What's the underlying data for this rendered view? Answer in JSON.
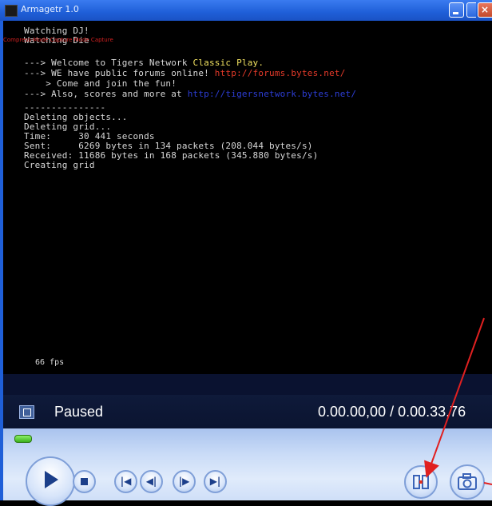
{
  "window": {
    "title": "Armagetr 1.0"
  },
  "overlay_text": "Compress-Mode Capture Mode Capture",
  "console": {
    "lines": [
      [
        {
          "t": "Watching DJ!"
        }
      ],
      [
        {
          "t": "Watching Die"
        }
      ],
      [
        {
          "t": "---> Welcome to Tigers Network "
        },
        {
          "t": "Classic Play.",
          "c": "y"
        }
      ],
      [
        {
          "t": "---> WE have public forums online! "
        },
        {
          "t": "http://forums.bytes.net/",
          "c": "r"
        }
      ],
      [
        {
          "t": "    > Come and join the fun!"
        }
      ],
      [
        {
          "t": "---> Also, scores and more at "
        },
        {
          "t": "http://tigersnetwork.bytes.net/",
          "c": "b"
        }
      ],
      [
        {
          "t": "---------------"
        }
      ],
      [
        {
          "t": "Deleting objects..."
        }
      ],
      [
        {
          "t": "Deleting grid..."
        }
      ],
      [
        {
          "t": "Time:     30 441 seconds"
        }
      ],
      [
        {
          "t": "Sent:     6269 bytes in 134 packets (208.044 bytes/s)"
        }
      ],
      [
        {
          "t": "Received: 11686 bytes in 168 packets (345.880 bytes/s)"
        }
      ],
      [
        {
          "t": "Creating grid"
        }
      ]
    ],
    "fps": "66 fps"
  },
  "player": {
    "status": "Paused",
    "time": "0.00.00,00 / 0.00.33,76",
    "seek_fraction": 0.0
  },
  "icons": {
    "view": "view-mode-icon",
    "play": "play-icon",
    "stop": "stop-icon",
    "prev": "previous-icon",
    "rew": "rewind-icon",
    "fwd": "fast-forward-icon",
    "next": "next-icon",
    "fullscreen": "fullscreen-icon",
    "capture": "camera-icon"
  },
  "colors": {
    "highlight_yellow": "#f0e060",
    "highlight_red": "#e53a2a",
    "highlight_blue": "#2d3ed8",
    "annotation_arrow": "#e02020"
  }
}
